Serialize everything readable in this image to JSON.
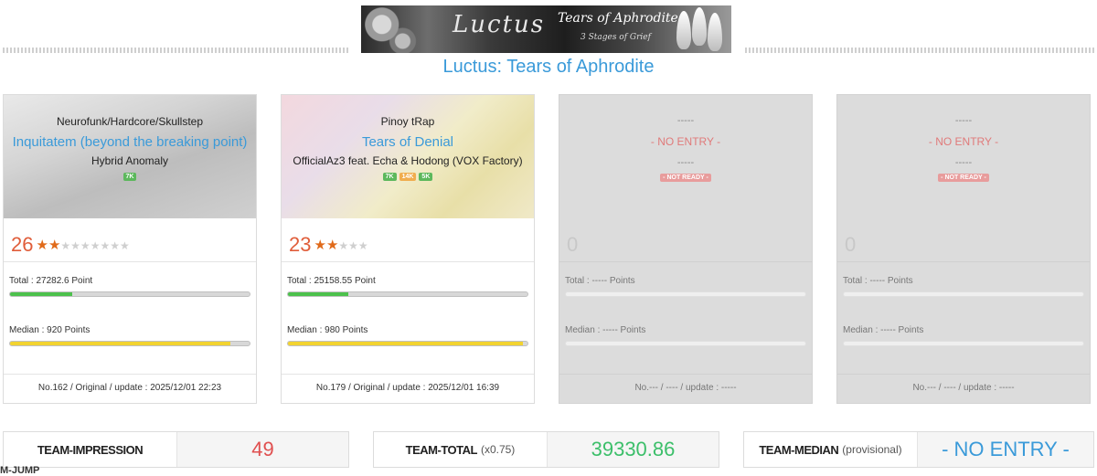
{
  "banner": {
    "title": "Luctus",
    "subtitle": "Tears of Aphrodite",
    "tagline": "3 Stages of Grief"
  },
  "song_title": "Luctus: Tears of Aphrodite",
  "cards": [
    {
      "genre": "Neurofunk/Hardcore/Skullstep",
      "title": "Inquitatem (beyond the breaking point)",
      "artist": "Hybrid Anomaly",
      "badges": [
        "7K"
      ],
      "rating": "26",
      "stars_on": 2,
      "stars_off": 7,
      "total_label": "Total : 27282.6 Point",
      "total_fill": 0.26,
      "median_label": "Median : 920 Points",
      "median_fill": 0.92,
      "footer": "No.162 / Original / update : 2025/12/01 22:23"
    },
    {
      "genre": "Pinoy tRap",
      "title": "Tears of Denial",
      "artist": "OfficialAz3 feat. Echa & Hodong (VOX Factory)",
      "badges": [
        "7K",
        "14K",
        "5K"
      ],
      "rating": "23",
      "stars_on": 2,
      "stars_off": 3,
      "total_label": "Total : 25158.55 Point",
      "total_fill": 0.25,
      "median_label": "Median : 980 Points",
      "median_fill": 0.98,
      "footer": "No.179 / Original / update : 2025/12/01 16:39"
    },
    {
      "dash": "-----",
      "no_entry": "- NO ENTRY -",
      "dash2": "-----",
      "badge": "- NOT READY -",
      "rating": "0",
      "total_label": "Total : ----- Points",
      "median_label": "Median : ----- Points",
      "footer": "No.--- / ---- / update : -----"
    },
    {
      "dash": "-----",
      "no_entry": "- NO ENTRY -",
      "dash2": "-----",
      "badge": "- NOT READY -",
      "rating": "0",
      "total_label": "Total : ----- Points",
      "median_label": "Median : ----- Points",
      "footer": "No.--- / ---- / update : -----"
    }
  ],
  "team": {
    "impression_label": "TEAM-IMPRESSION",
    "impression_value": "49",
    "total_label": "TEAM-TOTAL",
    "total_mult": "(x0.75)",
    "total_value": "39330.86",
    "median_label": "TEAM-MEDIAN",
    "median_note": "(provisional)",
    "median_value": "- NO ENTRY -"
  },
  "jump_label": "M-JUMP",
  "colors": {
    "accent_blue": "#3a9ad9",
    "rating_red": "#e05d3a",
    "star_orange": "#e06a1a",
    "bar_green": "#4cc14c",
    "bar_yellow": "#f2d330",
    "value_green": "#3cbf6a"
  }
}
